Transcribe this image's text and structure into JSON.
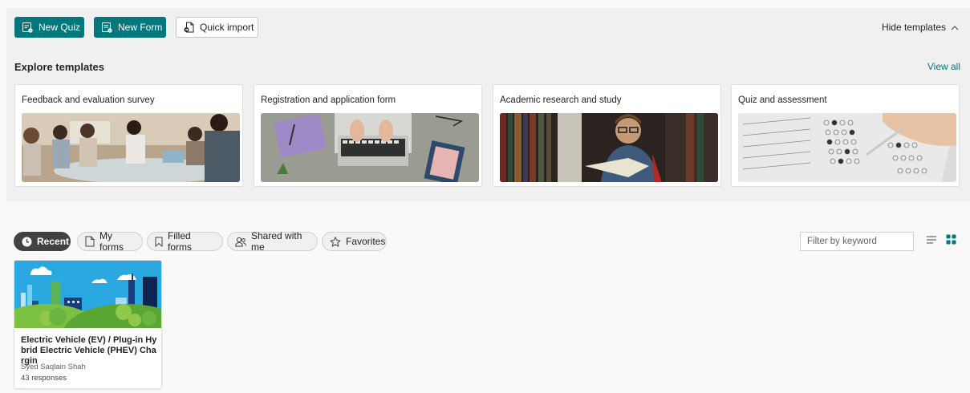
{
  "toolbar": {
    "new_quiz_label": "New Quiz",
    "new_form_label": "New Form",
    "quick_import_label": "Quick import",
    "hide_templates_label": "Hide templates"
  },
  "templates": {
    "heading": "Explore templates",
    "view_all_label": "View all",
    "items": [
      {
        "label": "Feedback and evaluation survey"
      },
      {
        "label": "Registration and application form"
      },
      {
        "label": "Academic research and study"
      },
      {
        "label": "Quiz and assessment"
      }
    ]
  },
  "filters": {
    "tabs": [
      {
        "label": "Recent",
        "active": true
      },
      {
        "label": "My forms"
      },
      {
        "label": "Filled forms"
      },
      {
        "label": "Shared with me"
      },
      {
        "label": "Favorites"
      }
    ],
    "keyword_placeholder": "Filter by keyword"
  },
  "forms": [
    {
      "title": "Electric Vehicle (EV) / Plug-in Hybrid Electric Vehicle (PHEV) Chargin",
      "owner": "Syed Saqlain Shah",
      "responses": "43 responses"
    }
  ],
  "colors": {
    "brand": "#03787c",
    "active_pill": "#424242",
    "panel_bg": "#f0f0f0"
  }
}
